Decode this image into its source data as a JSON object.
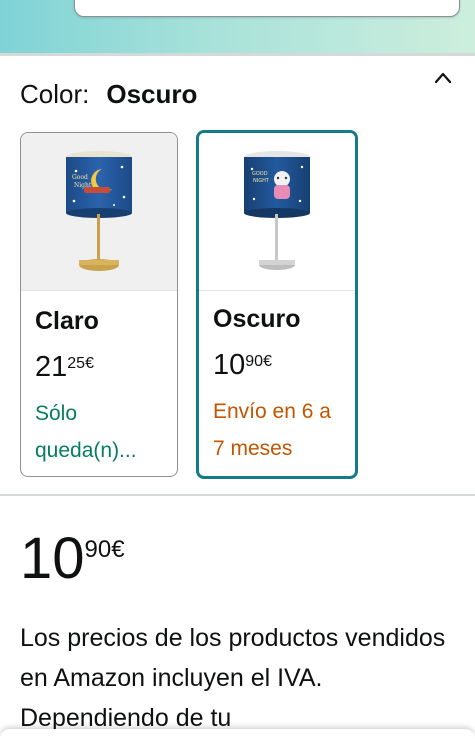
{
  "variation": {
    "label": "Color:",
    "selected_value": "Oscuro",
    "collapse_icon": "chevron-up-icon"
  },
  "swatches": [
    {
      "name": "Claro",
      "price_whole": "21",
      "price_fraction": "25",
      "currency": "€",
      "availability": "Sólo queda(n)...",
      "availability_color": "#067d62",
      "selected": false
    },
    {
      "name": "Oscuro",
      "price_whole": "10",
      "price_fraction": "90",
      "currency": "€",
      "availability": "Envío en 6 a 7 meses",
      "availability_color": "#c45500",
      "selected": true
    }
  ],
  "price": {
    "whole": "10",
    "fraction": "90",
    "currency": "€"
  },
  "tax_note": "Los precios de los productos vendidos en Amazon incluyen el IVA. Dependiendo de tu",
  "colors": {
    "accent_selected_border": "#137c88",
    "in_stock_green": "#067d62",
    "delivery_orange": "#c45500",
    "lamp_shade_blue": "#1f4e8c"
  }
}
